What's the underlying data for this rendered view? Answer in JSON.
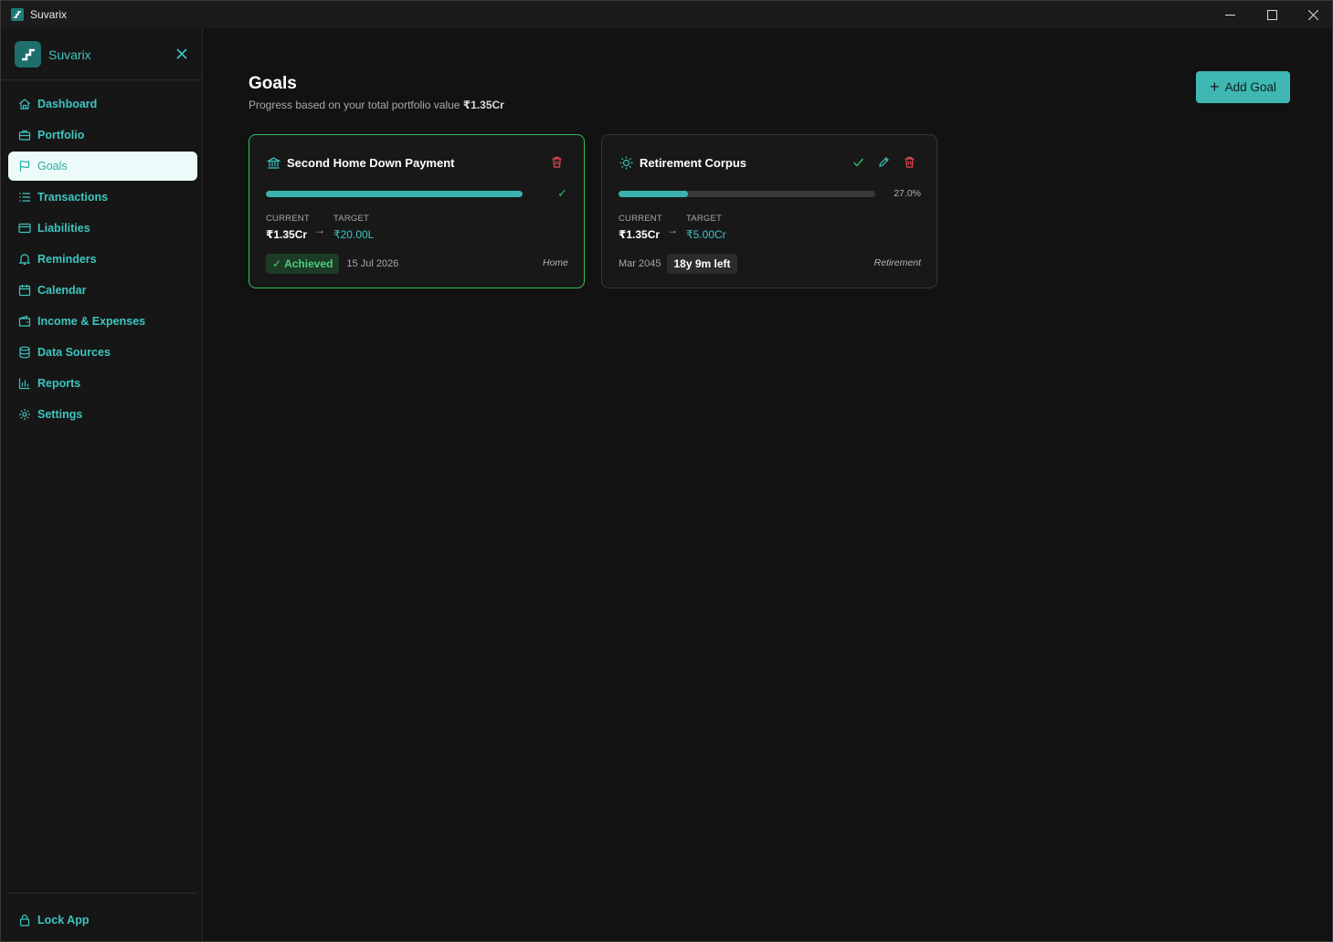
{
  "window": {
    "title": "Suvarix"
  },
  "sidebar": {
    "brand": "Suvarix",
    "items": [
      {
        "label": "Dashboard",
        "icon": "home-icon"
      },
      {
        "label": "Portfolio",
        "icon": "briefcase-icon"
      },
      {
        "label": "Goals",
        "icon": "flag-icon",
        "active": true
      },
      {
        "label": "Transactions",
        "icon": "list-icon"
      },
      {
        "label": "Liabilities",
        "icon": "credit-card-icon"
      },
      {
        "label": "Reminders",
        "icon": "bell-icon"
      },
      {
        "label": "Calendar",
        "icon": "calendar-icon"
      },
      {
        "label": "Income & Expenses",
        "icon": "wallet-icon"
      },
      {
        "label": "Data Sources",
        "icon": "database-icon"
      },
      {
        "label": "Reports",
        "icon": "bar-chart-icon"
      },
      {
        "label": "Settings",
        "icon": "gear-icon"
      }
    ],
    "lock_label": "Lock App"
  },
  "page": {
    "title": "Goals",
    "subtitle_prefix": "Progress based on your total portfolio value ",
    "subtitle_value": "₹1.35Cr",
    "add_button": "Add Goal"
  },
  "goals": [
    {
      "name": "Second Home Down Payment",
      "icon": "bank-icon",
      "progress": 1.0,
      "progress_text": "✓",
      "current_label": "CURRENT",
      "current_value": "₹1.35Cr",
      "target_label": "TARGET",
      "target_value": "₹20.00L",
      "status": "Achieved",
      "date": "15 Jul 2026",
      "category": "Home"
    },
    {
      "name": "Retirement Corpus",
      "icon": "sun-icon",
      "progress": 0.27,
      "progress_text": "27.0%",
      "current_label": "CURRENT",
      "current_value": "₹1.35Cr",
      "target_label": "TARGET",
      "target_value": "₹5.00Cr",
      "date": "Mar 2045",
      "time_left": "18y 9m left",
      "category": "Retirement"
    }
  ],
  "colors": {
    "accent": "#3ec5c0",
    "success": "#2fbe5f",
    "danger": "#e5484d",
    "background": "#121212"
  }
}
